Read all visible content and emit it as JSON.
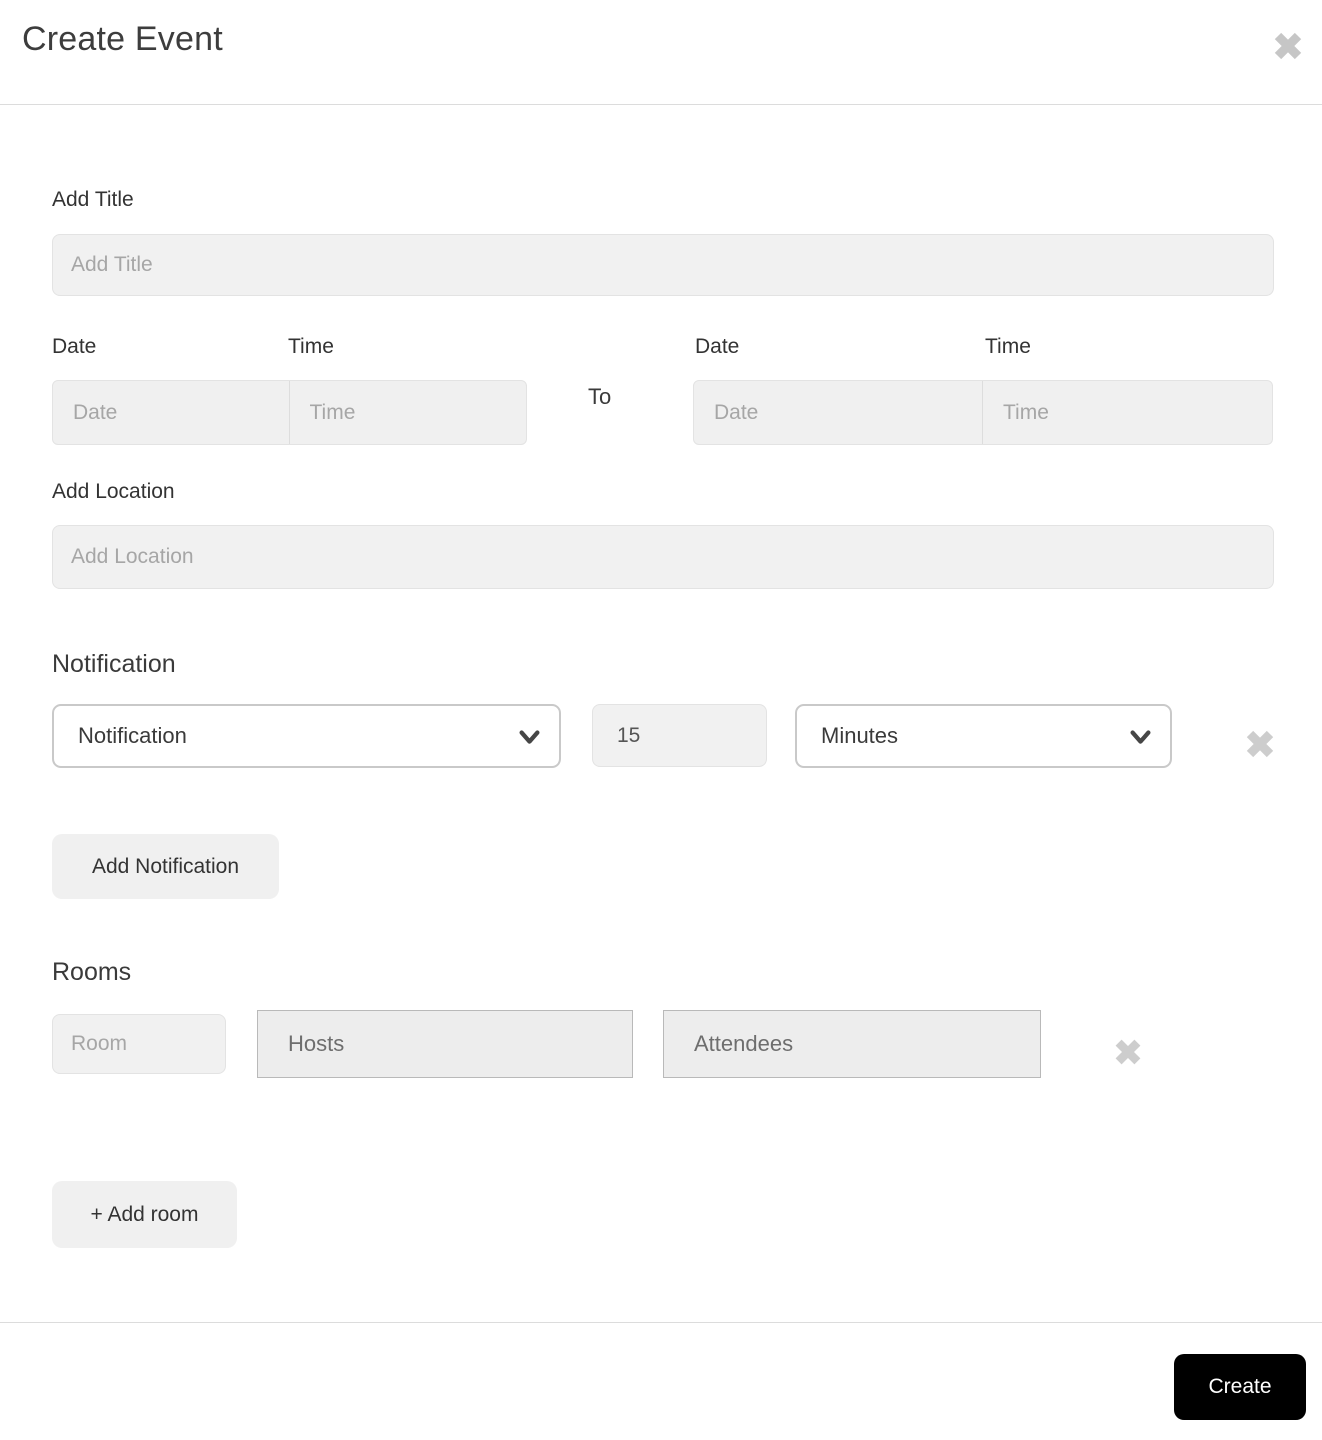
{
  "header": {
    "title": "Create Event"
  },
  "title_field": {
    "label": "Add Title",
    "placeholder": "Add Title"
  },
  "datetime": {
    "start": {
      "date_label": "Date",
      "time_label": "Time",
      "date_placeholder": "Date",
      "time_placeholder": "Time"
    },
    "separator": "To",
    "end": {
      "date_label": "Date",
      "time_label": "Time",
      "date_placeholder": "Date",
      "time_placeholder": "Time"
    }
  },
  "location_field": {
    "label": "Add Location",
    "placeholder": "Add Location"
  },
  "notification": {
    "heading": "Notification",
    "type_select_value": "Notification",
    "amount_value": "15",
    "unit_select_value": "Minutes",
    "add_button_label": "Add Notification"
  },
  "rooms": {
    "heading": "Rooms",
    "room_placeholder": "Room",
    "hosts_placeholder": "Hosts",
    "attendees_placeholder": "Attendees",
    "add_button_label": "+ Add room"
  },
  "footer": {
    "create_button_label": "Create"
  },
  "icons": {
    "close": "close-icon",
    "notification_remove": "x-remove-icon",
    "room_remove": "x-remove-icon",
    "select_chevron": "chevron-down-icon"
  },
  "colors": {
    "input_background": "#f1f1f1",
    "input_border": "#e3e3e3",
    "select_border": "#c9c9c9",
    "icon_gray": "#cbcbcb",
    "divider": "#dcdcdc",
    "primary_button_bg": "#000000",
    "primary_button_text": "#ffffff",
    "text_dark": "#3a3a3a",
    "placeholder_light": "#a6a6a6",
    "placeholder_dark": "#6e6e6e"
  }
}
